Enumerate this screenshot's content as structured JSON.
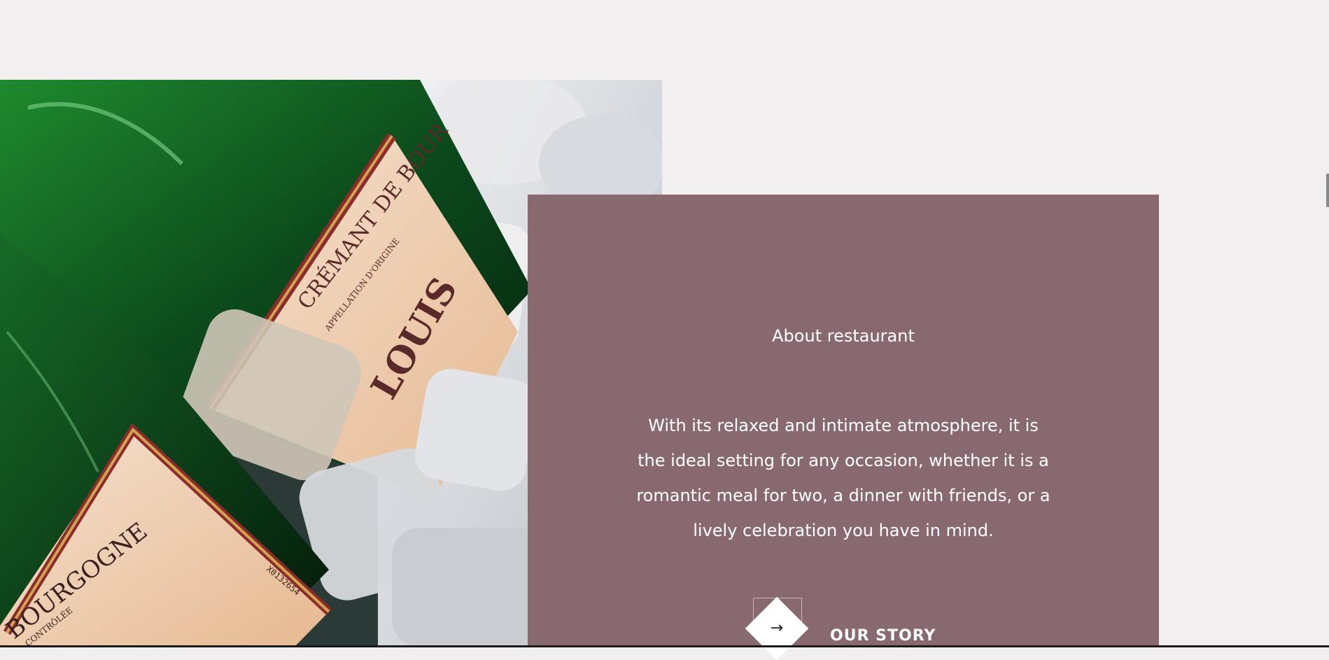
{
  "about": {
    "eyebrow": "About restaurant",
    "description": "With its relaxed and intimate atmosphere, it is the ideal setting for any occasion, whether it is a romantic meal for two, a dinner with friends, or a lively celebration you have in mind.",
    "cta_label": "OUR STORY",
    "cta_icon": "arrow-right-icon",
    "cta_glyph": "→"
  },
  "photo": {
    "label_text_1": "CRÉMANT DE BOUR",
    "label_text_2": "APPELLATION D'ORIGINE",
    "label_text_3": "LOUIS",
    "label_text_4": "BOURGOGNE",
    "label_text_5": "CONTRÔLÉE",
    "label_text_6": "X0132654"
  },
  "colors": {
    "background": "#f2eff0",
    "card": "#886970",
    "text": "#ffffff"
  }
}
